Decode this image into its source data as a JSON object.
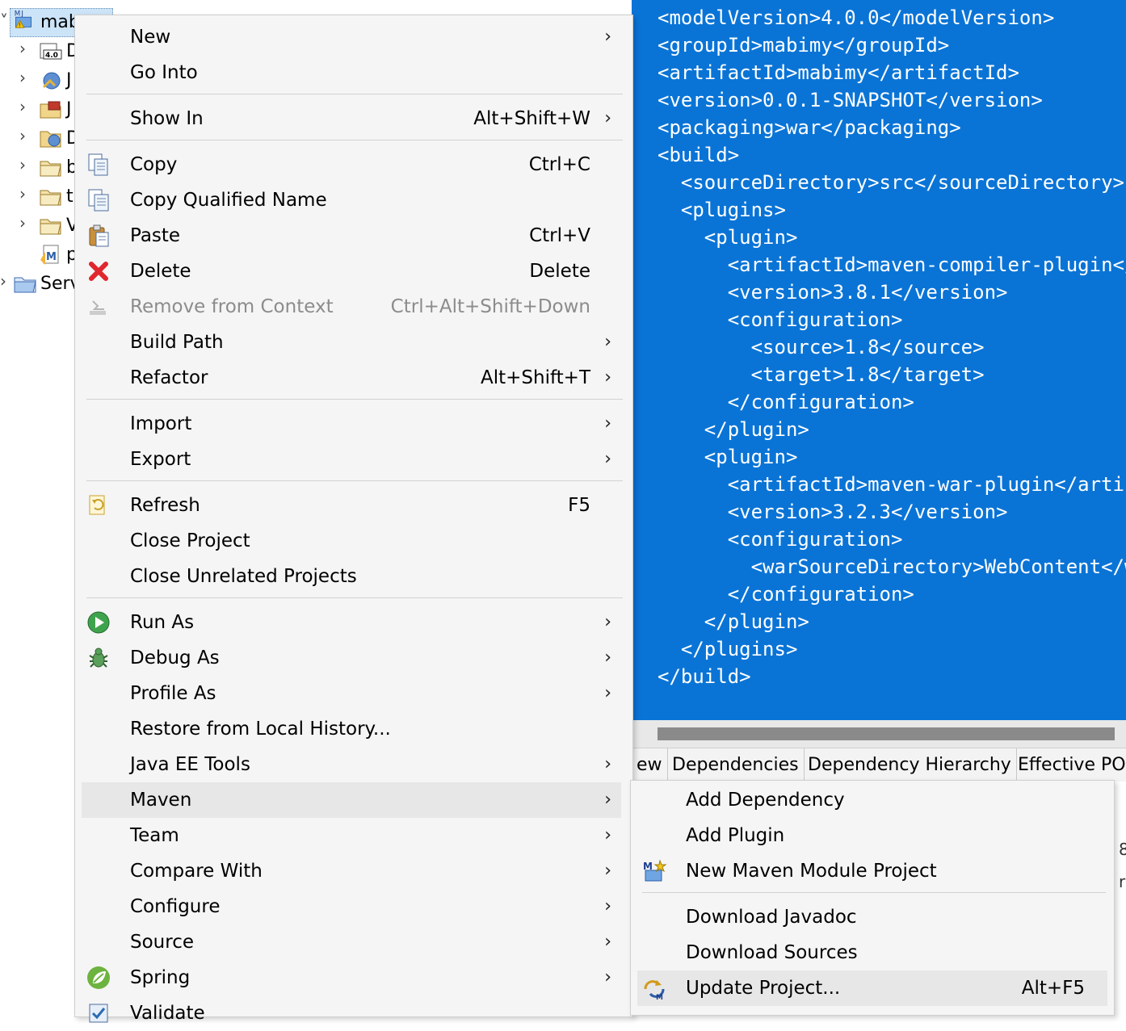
{
  "explorer": {
    "root_label": "mab",
    "items": [
      {
        "label": "D",
        "icon": "jre-library-icon"
      },
      {
        "label": "J",
        "icon": "jax-ws-icon"
      },
      {
        "label": "J",
        "icon": "java-resources-icon"
      },
      {
        "label": "D",
        "icon": "deployed-resources-icon"
      },
      {
        "label": "b",
        "icon": "folder-icon"
      },
      {
        "label": "t",
        "icon": "folder-icon"
      },
      {
        "label": "V",
        "icon": "folder-icon"
      },
      {
        "label": "p",
        "icon": "pom-file-icon"
      }
    ],
    "servers_label": "Serv"
  },
  "editor": {
    "lines": [
      "<modelVersion>4.0.0</modelVersion>",
      "<groupId>mabimy</groupId>",
      "<artifactId>mabimy</artifactId>",
      "<version>0.0.1-SNAPSHOT</version>",
      "<packaging>war</packaging>",
      "<build>",
      "  <sourceDirectory>src</sourceDirectory>",
      "  <plugins>",
      "    <plugin>",
      "      <artifactId>maven-compiler-plugin</artifactId>",
      "      <version>3.8.1</version>",
      "      <configuration>",
      "        <source>1.8</source>",
      "        <target>1.8</target>",
      "      </configuration>",
      "    </plugin>",
      "    <plugin>",
      "      <artifactId>maven-war-plugin</artifactId>",
      "      <version>3.2.3</version>",
      "      <configuration>",
      "        <warSourceDirectory>WebContent</warSourceDirectory>",
      "      </configuration>",
      "    </plugin>",
      "  </plugins>",
      "</build>"
    ],
    "selection_color": "#0a74d6"
  },
  "pom_tabs": [
    "ew",
    "Dependencies",
    "Dependency Hierarchy",
    "Effective POM"
  ],
  "right_strip": [
    "8",
    "r"
  ],
  "context_menu": {
    "items": [
      {
        "label": "New",
        "shortcut": "",
        "submenu": true
      },
      {
        "label": "Go Into",
        "shortcut": "",
        "submenu": false
      },
      {
        "label": "Show In",
        "shortcut": "Alt+Shift+W",
        "submenu": true
      },
      {
        "label": "Copy",
        "shortcut": "Ctrl+C",
        "submenu": false,
        "icon": "copy-icon"
      },
      {
        "label": "Copy Qualified Name",
        "shortcut": "",
        "submenu": false,
        "icon": "copy-qualified-name-icon"
      },
      {
        "label": "Paste",
        "shortcut": "Ctrl+V",
        "submenu": false,
        "icon": "paste-icon"
      },
      {
        "label": "Delete",
        "shortcut": "Delete",
        "submenu": false,
        "icon": "delete-icon"
      },
      {
        "label": "Remove from Context",
        "shortcut": "Ctrl+Alt+Shift+Down",
        "submenu": false,
        "disabled": true,
        "icon": "remove-context-icon"
      },
      {
        "label": "Build Path",
        "shortcut": "",
        "submenu": true
      },
      {
        "label": "Refactor",
        "shortcut": "Alt+Shift+T",
        "submenu": true
      },
      {
        "label": "Import",
        "shortcut": "",
        "submenu": true
      },
      {
        "label": "Export",
        "shortcut": "",
        "submenu": true
      },
      {
        "label": "Refresh",
        "shortcut": "F5",
        "submenu": false,
        "icon": "refresh-icon"
      },
      {
        "label": "Close Project",
        "shortcut": "",
        "submenu": false
      },
      {
        "label": "Close Unrelated Projects",
        "shortcut": "",
        "submenu": false
      },
      {
        "label": "Run As",
        "shortcut": "",
        "submenu": true,
        "icon": "run-icon"
      },
      {
        "label": "Debug As",
        "shortcut": "",
        "submenu": true,
        "icon": "debug-bug-icon"
      },
      {
        "label": "Profile As",
        "shortcut": "",
        "submenu": true
      },
      {
        "label": "Restore from Local History...",
        "shortcut": "",
        "submenu": false
      },
      {
        "label": "Java EE Tools",
        "shortcut": "",
        "submenu": true
      },
      {
        "label": "Maven",
        "shortcut": "",
        "submenu": true,
        "highlighted": true
      },
      {
        "label": "Team",
        "shortcut": "",
        "submenu": true
      },
      {
        "label": "Compare With",
        "shortcut": "",
        "submenu": true
      },
      {
        "label": "Configure",
        "shortcut": "",
        "submenu": true
      },
      {
        "label": "Source",
        "shortcut": "",
        "submenu": true
      },
      {
        "label": "Spring",
        "shortcut": "",
        "submenu": true,
        "icon": "spring-leaf-icon"
      },
      {
        "label": "Validate",
        "shortcut": "",
        "submenu": false,
        "icon": "validate-check-icon"
      }
    ],
    "arrow_glyph": "›"
  },
  "maven_submenu": {
    "items": [
      {
        "label": "Add Dependency",
        "shortcut": ""
      },
      {
        "label": "Add Plugin",
        "shortcut": ""
      },
      {
        "label": "New Maven Module Project",
        "shortcut": "",
        "icon": "maven-module-icon"
      },
      {
        "label": "Download Javadoc",
        "shortcut": ""
      },
      {
        "label": "Download Sources",
        "shortcut": ""
      },
      {
        "label": "Update Project...",
        "shortcut": "Alt+F5",
        "icon": "update-project-icon",
        "highlighted": true
      }
    ]
  }
}
